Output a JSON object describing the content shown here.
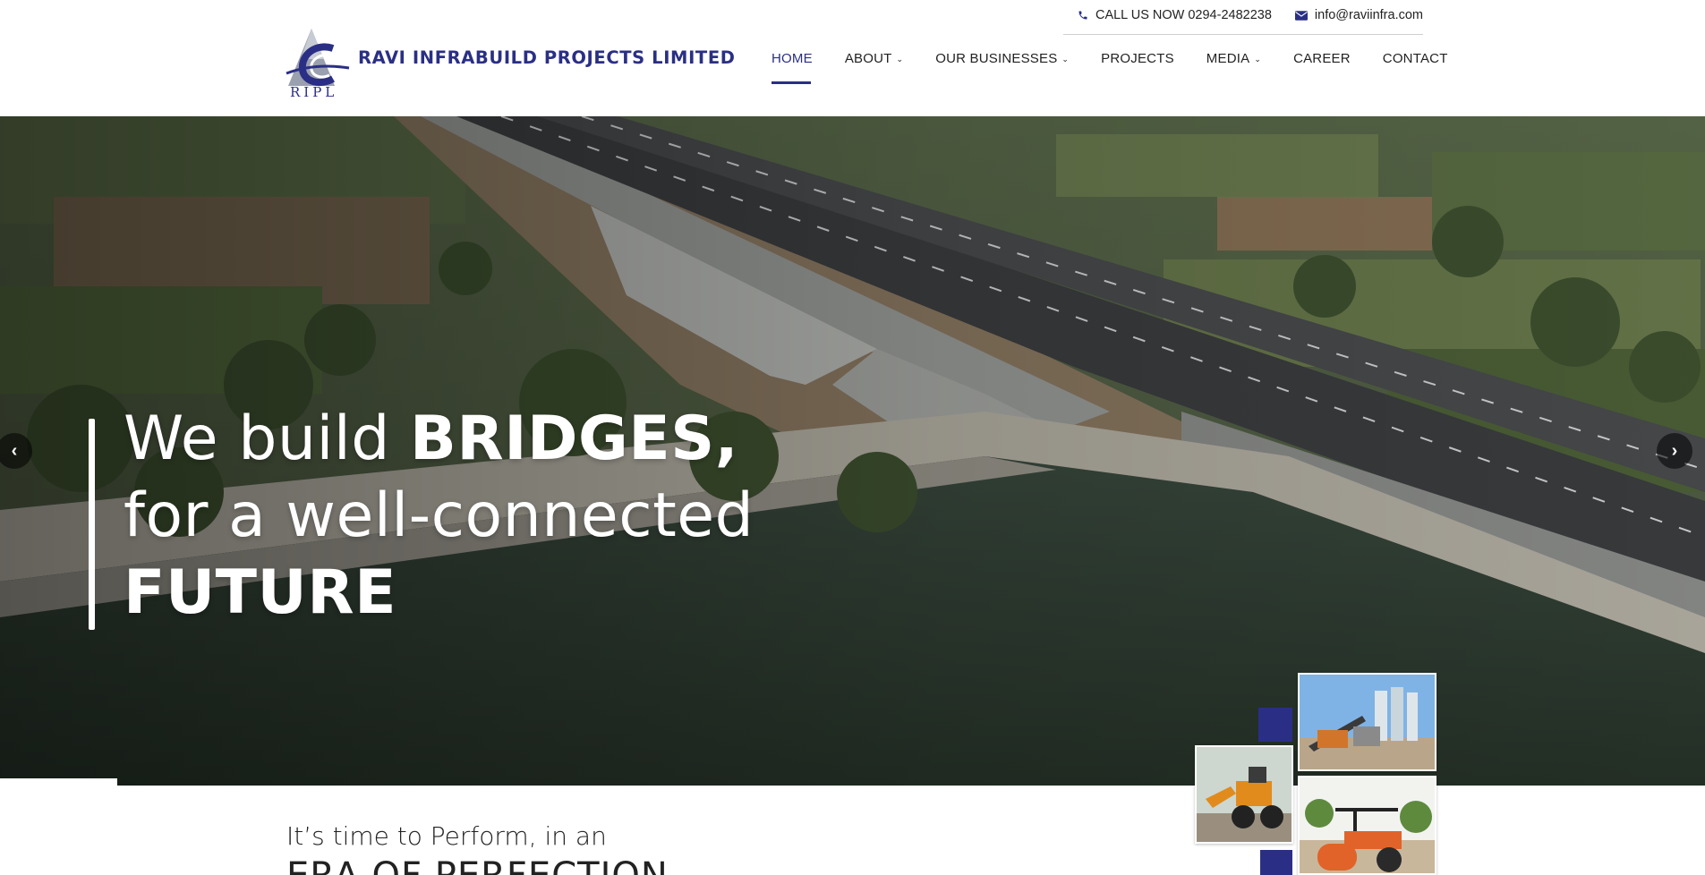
{
  "company": {
    "name": "RAVI INFRABUILD PROJECTS LIMITED",
    "abbr": "RIPL"
  },
  "topbar": {
    "phone_label": "CALL US NOW 0294-2482238",
    "email_label": "info@raviinfra.com"
  },
  "nav": {
    "items": [
      {
        "label": "HOME",
        "active": true
      },
      {
        "label": "ABOUT",
        "dropdown": true
      },
      {
        "label": "OUR BUSINESSES",
        "dropdown": true
      },
      {
        "label": "PROJECTS"
      },
      {
        "label": "MEDIA",
        "dropdown": true
      },
      {
        "label": "CAREER"
      },
      {
        "label": "CONTACT"
      }
    ]
  },
  "hero": {
    "line1_regular": "We build ",
    "line1_bold": "BRIDGES,",
    "line2": "for a well-connected",
    "line3_bold": "FUTURE"
  },
  "intro": {
    "line1": "It’s time to Perform, in an",
    "line2": "ERA OF PERFECTION"
  },
  "colors": {
    "brand_navy": "#2a2f85",
    "text": "#222222",
    "white": "#ffffff"
  },
  "icons": {
    "phone": "phone-icon",
    "email": "envelope-icon",
    "prev": "chevron-left-icon",
    "next": "chevron-right-icon"
  }
}
